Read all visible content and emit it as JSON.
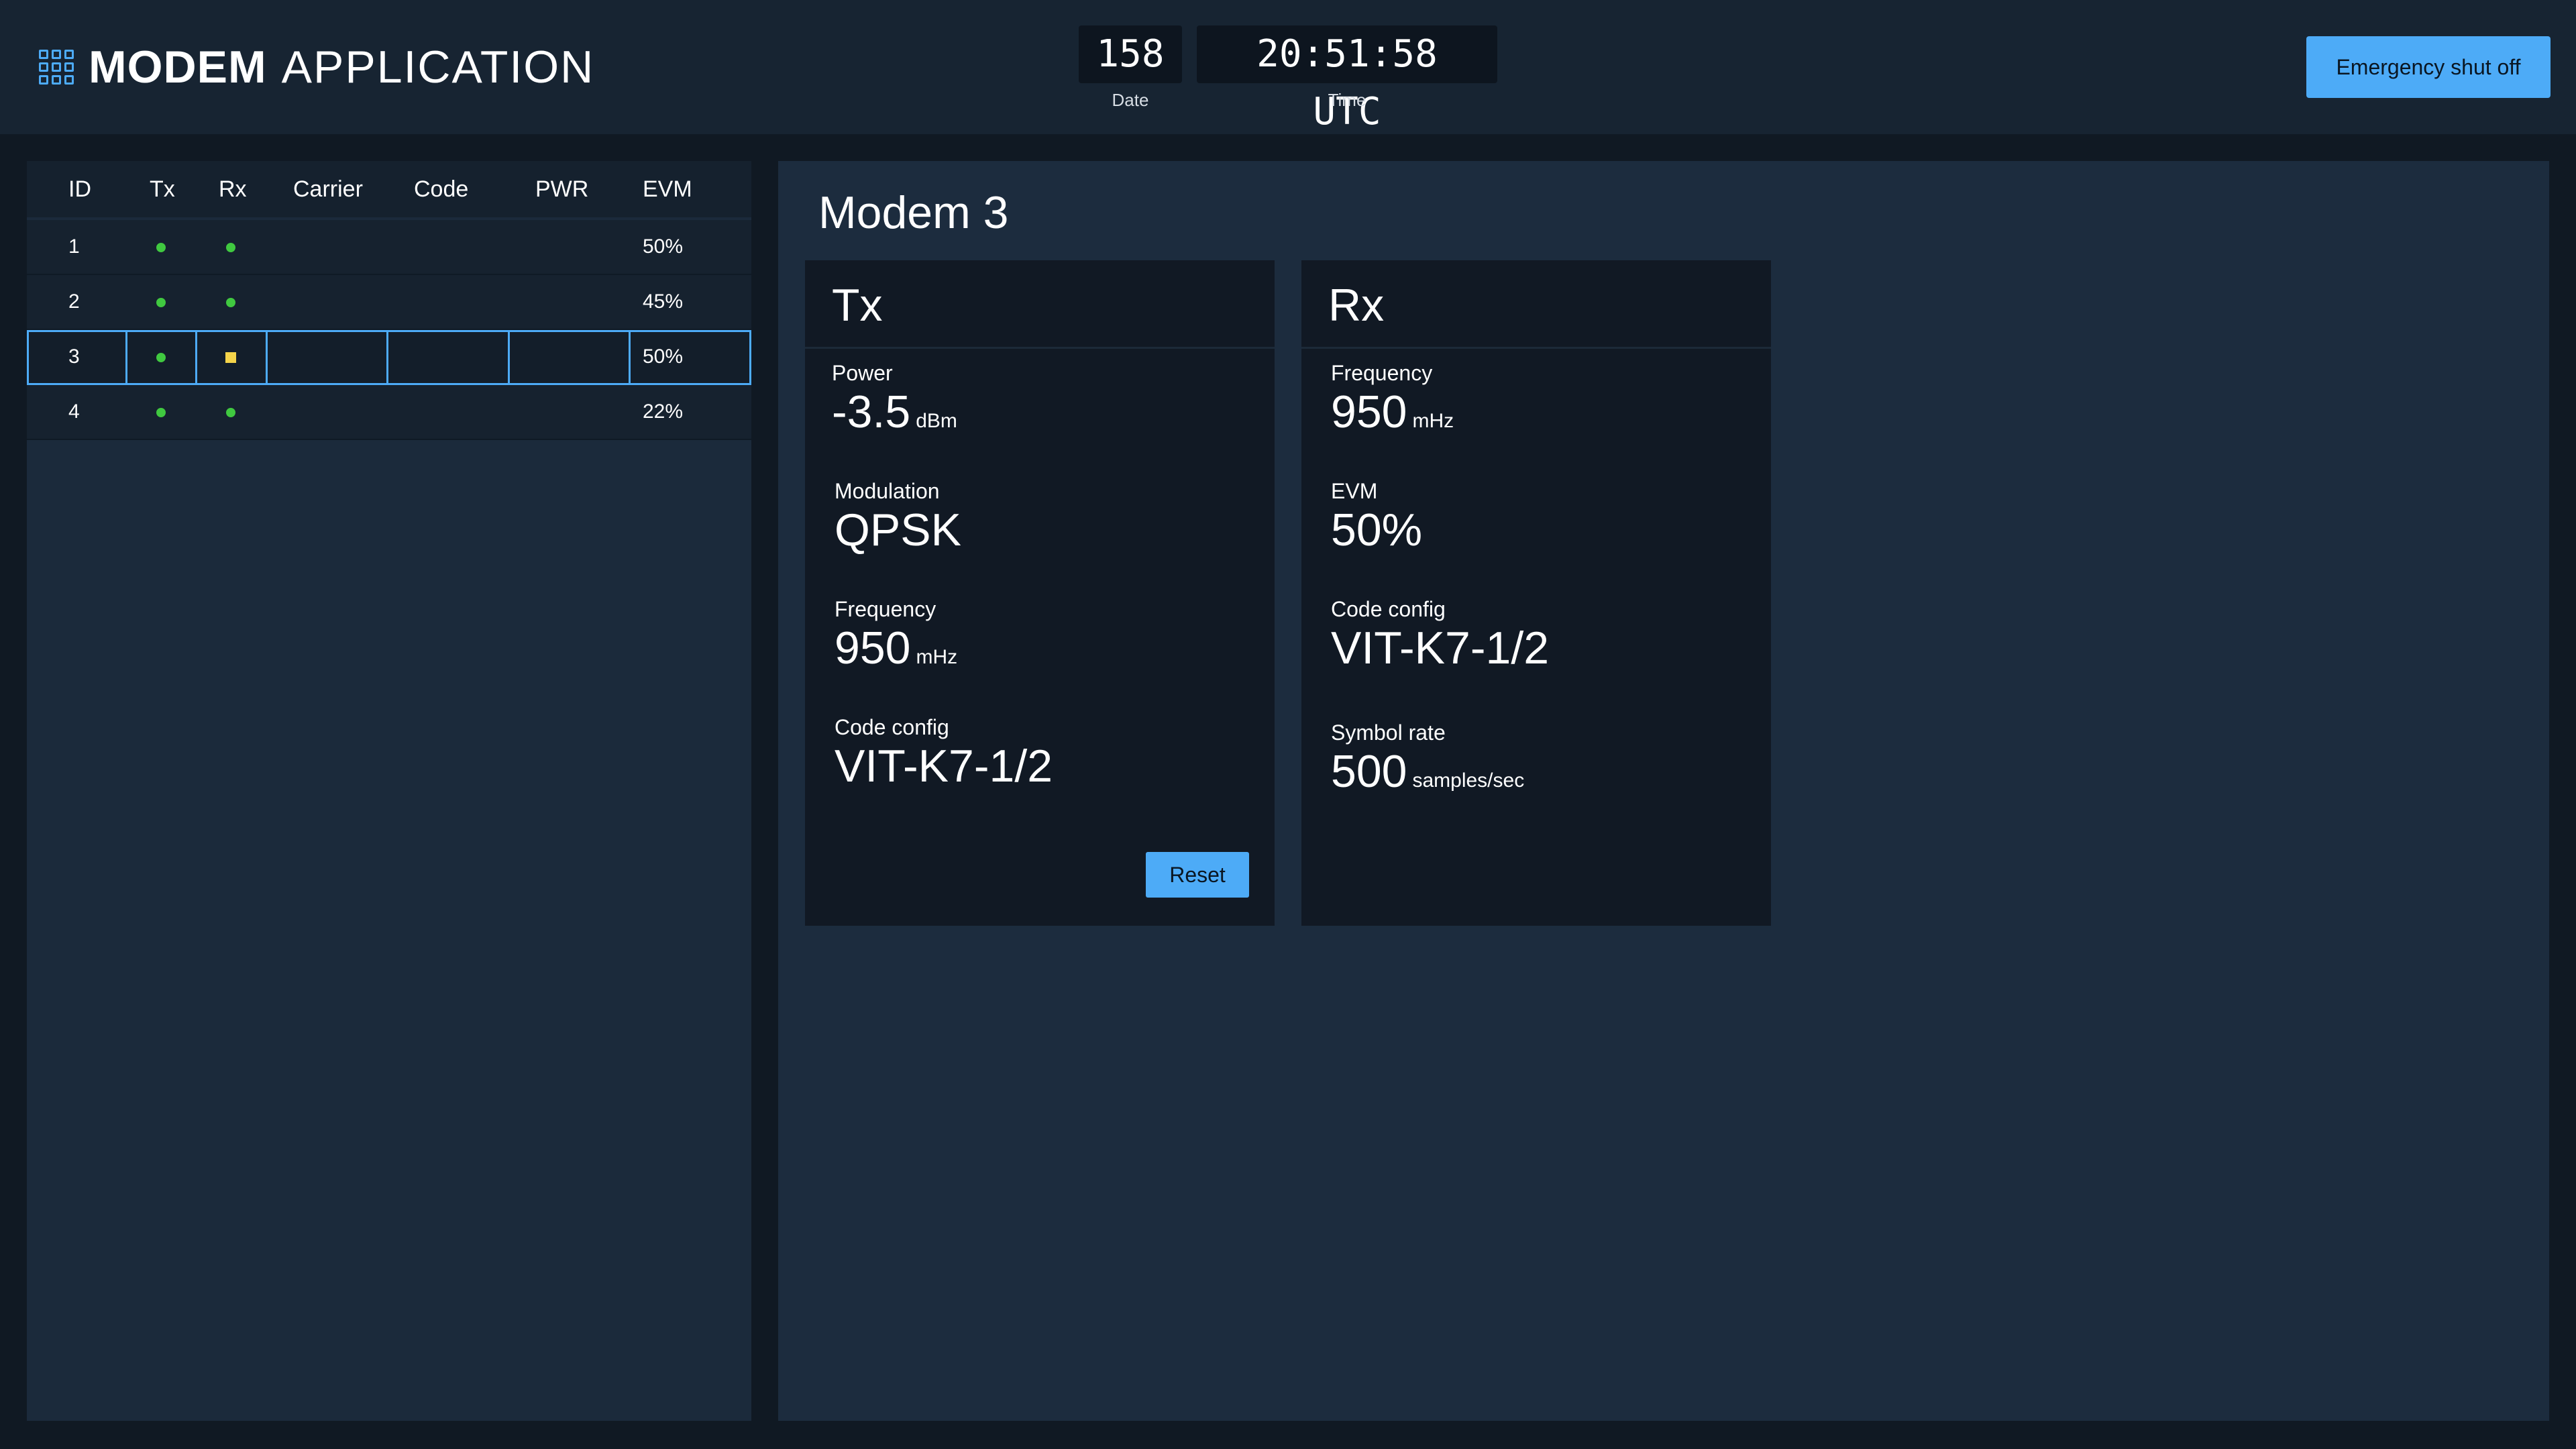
{
  "header": {
    "title_bold": "MODEM",
    "title_light": "APPLICATION",
    "app_icon": "grid-icon",
    "date_value": "158",
    "date_label": "Date",
    "time_value": "20:51:58 UTC",
    "time_label": "Time",
    "emergency_label": "Emergency shut off"
  },
  "table": {
    "columns": [
      "ID",
      "Tx",
      "Rx",
      "Carrier",
      "Code",
      "PWR",
      "EVM"
    ],
    "rows": [
      {
        "id": "1",
        "tx": "ok",
        "rx": "ok",
        "carrier": "",
        "code": "",
        "pwr": "",
        "evm": "50%"
      },
      {
        "id": "2",
        "tx": "ok",
        "rx": "ok",
        "carrier": "",
        "code": "",
        "pwr": "",
        "evm": "45%"
      },
      {
        "id": "3",
        "tx": "ok",
        "rx": "warning",
        "carrier": "",
        "code": "",
        "pwr": "",
        "evm": "50%",
        "selected": true
      },
      {
        "id": "4",
        "tx": "ok",
        "rx": "ok",
        "carrier": "",
        "code": "",
        "pwr": "",
        "evm": "22%"
      }
    ]
  },
  "detail": {
    "title": "Modem 3",
    "tx": {
      "title": "Tx",
      "power_label": "Power",
      "power_value": "-3.5",
      "power_unit": "dBm",
      "modulation_label": "Modulation",
      "modulation_value": "QPSK",
      "frequency_label": "Frequency",
      "frequency_value": "950",
      "frequency_unit": "mHz",
      "code_label": "Code config",
      "code_value": "VIT-K7-1/2",
      "reset_label": "Reset"
    },
    "rx": {
      "title": "Rx",
      "frequency_label": "Frequency",
      "frequency_value": "950",
      "frequency_unit": "mHz",
      "evm_label": "EVM",
      "evm_value": "50%",
      "code_label": "Code config",
      "code_value": "VIT-K7-1/2",
      "symbol_label": "Symbol rate",
      "symbol_value": "500",
      "symbol_unit": "samples/sec"
    }
  },
  "colors": {
    "accent": "#4dabf7",
    "status_ok": "#40c940",
    "status_warning": "#f5d44a"
  }
}
